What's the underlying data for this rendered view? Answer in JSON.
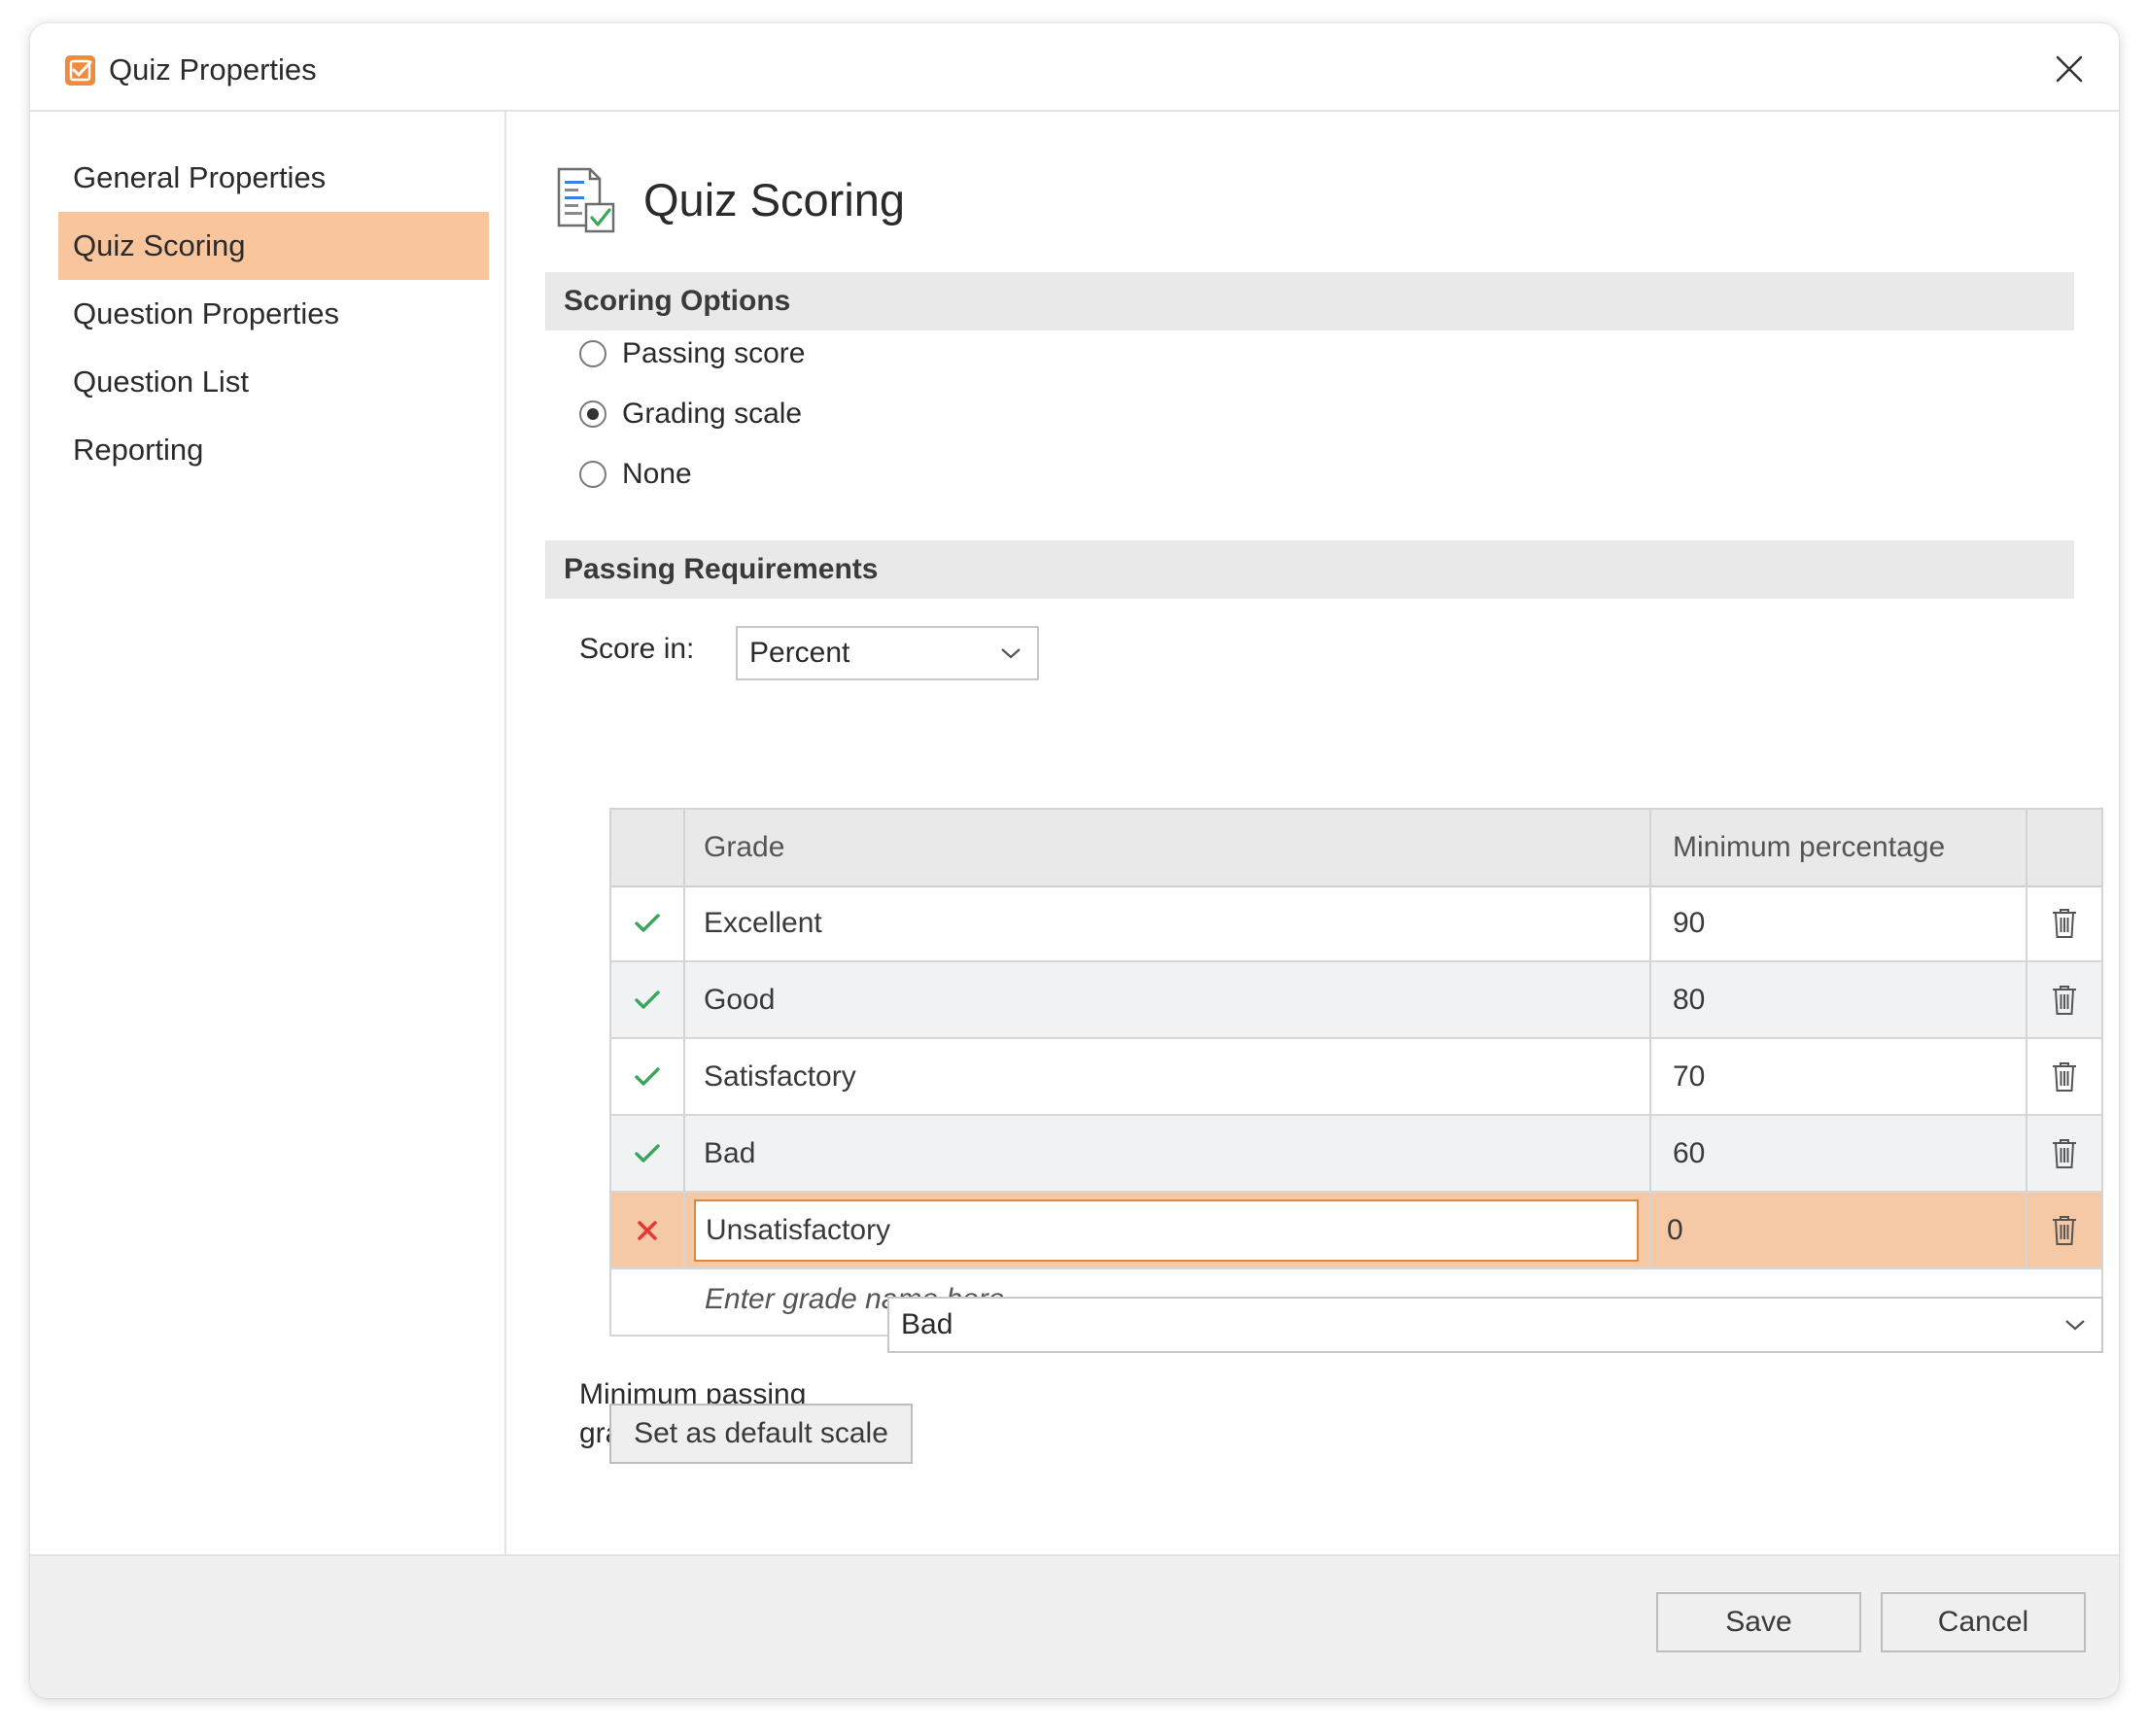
{
  "window": {
    "title": "Quiz Properties",
    "app_icon": "checkbox-icon",
    "close_icon": "close-icon"
  },
  "sidebar": {
    "items": [
      {
        "label": "General Properties",
        "active": false
      },
      {
        "label": "Quiz Scoring",
        "active": true
      },
      {
        "label": "Question Properties",
        "active": false
      },
      {
        "label": "Question List",
        "active": false
      },
      {
        "label": "Reporting",
        "active": false
      }
    ]
  },
  "page": {
    "title": "Quiz Scoring",
    "icon": "document-check-icon"
  },
  "scoring_options": {
    "header": "Scoring Options",
    "options": [
      {
        "label": "Passing score",
        "checked": false
      },
      {
        "label": "Grading scale",
        "checked": true
      },
      {
        "label": "None",
        "checked": false
      }
    ]
  },
  "passing_requirements": {
    "header": "Passing Requirements",
    "score_in_label": "Score in:",
    "score_in_value": "Percent",
    "table": {
      "columns": [
        "",
        "Grade",
        "Minimum percentage",
        ""
      ],
      "rows": [
        {
          "status": "pass",
          "grade": "Excellent",
          "min": "90"
        },
        {
          "status": "pass",
          "grade": "Good",
          "min": "80"
        },
        {
          "status": "pass",
          "grade": "Satisfactory",
          "min": "70"
        },
        {
          "status": "pass",
          "grade": "Bad",
          "min": "60"
        },
        {
          "status": "fail",
          "grade": "Unsatisfactory",
          "min": "0"
        }
      ],
      "new_row_placeholder": "Enter grade name here"
    },
    "min_passing_label": "Minimum passing grade:",
    "min_passing_value": "Bad",
    "default_button": "Set as default scale"
  },
  "footer": {
    "save": "Save",
    "cancel": "Cancel"
  },
  "colors": {
    "accent": "#f8c59d",
    "selected_row": "#f6c9a6",
    "pass": "#3aa65a",
    "fail": "#e53935",
    "icon_orange": "#f08a3c"
  }
}
